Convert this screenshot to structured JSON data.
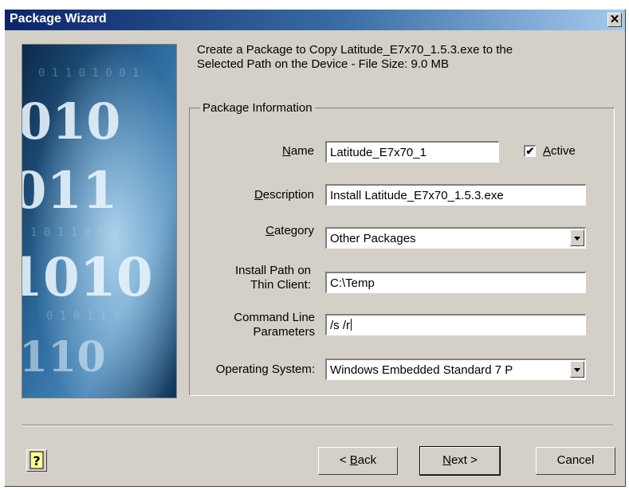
{
  "window": {
    "title": "Package Wizard",
    "close_icon": "close-icon"
  },
  "intro": {
    "line1": "Create a Package to Copy Latitude_E7x70_1.5.3.exe to the",
    "line2": "Selected Path on the Device  -  File Size: 9.0 MB"
  },
  "art": {
    "icon": "binary-digits-banner",
    "rows": [
      "010",
      "011",
      "1010",
      "110"
    ]
  },
  "package_info": {
    "group_label": "Package Information",
    "name": {
      "label_u": "N",
      "label_rest": "ame",
      "value": "Latitude_E7x70_1"
    },
    "active": {
      "label_u": "A",
      "label_rest": "ctive",
      "checked": true,
      "check_glyph": "✔"
    },
    "description": {
      "label_u": "D",
      "label_rest": "escription",
      "value": "Install Latitude_E7x70_1.5.3.exe"
    },
    "category": {
      "label_u": "C",
      "label_rest": "ategory",
      "value": "Other Packages"
    },
    "install_path": {
      "label_line1": "Install Path on",
      "label_line2": "Thin Client:",
      "value": "C:\\Temp"
    },
    "command_line": {
      "label_line1": "Command Line",
      "label_line2": "Parameters",
      "value": "/s /r"
    },
    "operating_system": {
      "label": "Operating System:",
      "value": "Windows Embedded Standard 7 P"
    }
  },
  "buttons": {
    "help_icon": "help-icon",
    "help_glyph": "?",
    "back": {
      "pre": "< ",
      "u": "B",
      "rest": "ack"
    },
    "next": {
      "u": "N",
      "rest": "ext >"
    },
    "cancel": "Cancel"
  },
  "colors": {
    "titlebar_start": "#0a246a",
    "titlebar_end": "#a6caf0",
    "dialog_face": "#d4d0c8",
    "art_dark": "#0c2a4a",
    "art_light": "#7fb6dc"
  }
}
